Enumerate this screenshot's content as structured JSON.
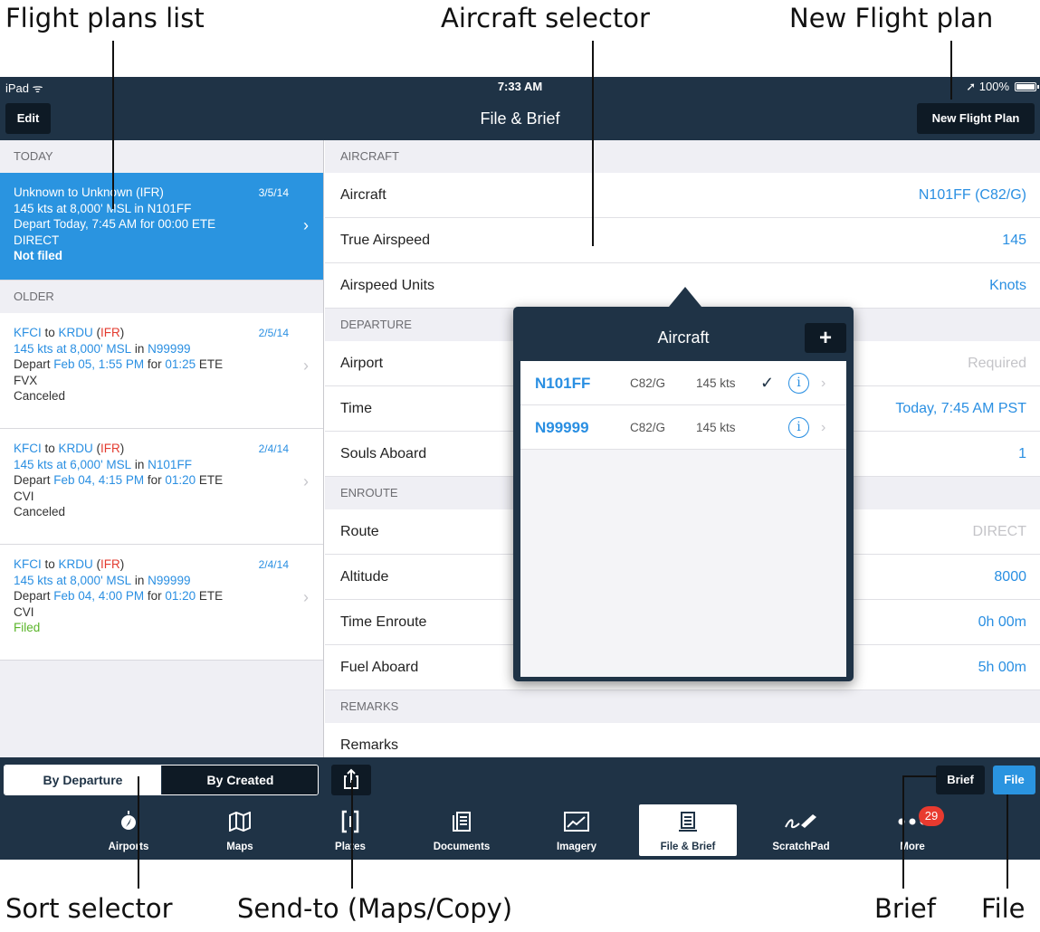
{
  "callouts": {
    "flight_plans_list": "Flight plans list",
    "aircraft_selector": "Aircraft selector",
    "new_flight_plan": "New Flight plan",
    "sort_selector": "Sort selector",
    "send_to": "Send-to (Maps/Copy)",
    "brief": "Brief",
    "file": "File"
  },
  "status_bar": {
    "device": "iPad",
    "time": "7:33 AM",
    "battery": "100%"
  },
  "nav": {
    "edit": "Edit",
    "title": "File & Brief",
    "new_flight_plan": "New Flight Plan"
  },
  "plans": {
    "today_header": "TODAY",
    "older_header": "OLDER",
    "today": {
      "from": "Unknown",
      "to_word": " to ",
      "to": "Unknown",
      "rules": "IFR",
      "date": "3/5/14",
      "line2": "145 kts at 8,000' MSL in N101FF",
      "line3": "Depart Today, 7:45 AM for 00:00 ETE",
      "route": "DIRECT",
      "status": "Not filed"
    },
    "older": [
      {
        "from": "KFCI",
        "to": "KRDU",
        "rules": "IFR",
        "date": "2/5/14",
        "speed_alt": "145 kts at 8,000' MSL",
        "in_word": " in ",
        "tail": "N99999",
        "depart_word": "Depart ",
        "depart": "Feb 05, 1:55 PM",
        "for_word": " for ",
        "ete": "01:25",
        "ete_word": " ETE",
        "route": "FVX",
        "status": "Canceled"
      },
      {
        "from": "KFCI",
        "to": "KRDU",
        "rules": "IFR",
        "date": "2/4/14",
        "speed_alt": "145 kts at 6,000' MSL",
        "in_word": " in ",
        "tail": "N101FF",
        "depart_word": "Depart ",
        "depart": "Feb 04, 4:15 PM",
        "for_word": " for ",
        "ete": "01:20",
        "ete_word": " ETE",
        "route": "CVI",
        "status": "Canceled"
      },
      {
        "from": "KFCI",
        "to": "KRDU",
        "rules": "IFR",
        "date": "2/4/14",
        "speed_alt": "145 kts at 8,000' MSL",
        "in_word": " in ",
        "tail": "N99999",
        "depart_word": "Depart ",
        "depart": "Feb 04, 4:00 PM",
        "for_word": " for ",
        "ete": "01:20",
        "ete_word": " ETE",
        "route": "CVI",
        "status": "Filed"
      }
    ]
  },
  "form": {
    "aircraft_section": "AIRCRAFT",
    "aircraft_label": "Aircraft",
    "aircraft_value": "N101FF (C82/G)",
    "tas_label": "True Airspeed",
    "tas_value": "145",
    "units_label": "Airspeed Units",
    "units_value": "Knots",
    "departure_section": "DEPARTURE",
    "airport_label": "Airport",
    "airport_placeholder": "Required",
    "time_label": "Time",
    "time_value": "Today, 7:45 AM PST",
    "souls_label": "Souls Aboard",
    "souls_value": "1",
    "enroute_section": "ENROUTE",
    "route_label": "Route",
    "route_placeholder": "DIRECT",
    "altitude_label": "Altitude",
    "altitude_value": "8000",
    "ete_label": "Time Enroute",
    "ete_value": "0h 00m",
    "fuel_label": "Fuel Aboard",
    "fuel_value": "5h 00m",
    "remarks_section": "REMARKS",
    "remarks_label": "Remarks"
  },
  "popover": {
    "title": "Aircraft",
    "add": "+",
    "aircraft": [
      {
        "tail": "N101FF",
        "type": "C82/G",
        "speed": "145 kts",
        "check": "✓",
        "info": "i",
        "chev": "›"
      },
      {
        "tail": "N99999",
        "type": "C82/G",
        "speed": "145 kts",
        "check": "",
        "info": "i",
        "chev": "›"
      }
    ]
  },
  "toolbar": {
    "by_departure": "By Departure",
    "by_created": "By Created",
    "brief": "Brief",
    "file": "File"
  },
  "tabs": {
    "airports": "Airports",
    "maps": "Maps",
    "plates": "Plates",
    "documents": "Documents",
    "imagery": "Imagery",
    "file_brief": "File & Brief",
    "scratchpad": "ScratchPad",
    "more": "More",
    "more_badge": "29"
  },
  "colors": {
    "navy": "#1f3346",
    "accent_blue": "#2a94e0",
    "ifr_red": "#e33b2f",
    "filed_green": "#5bb52a"
  }
}
